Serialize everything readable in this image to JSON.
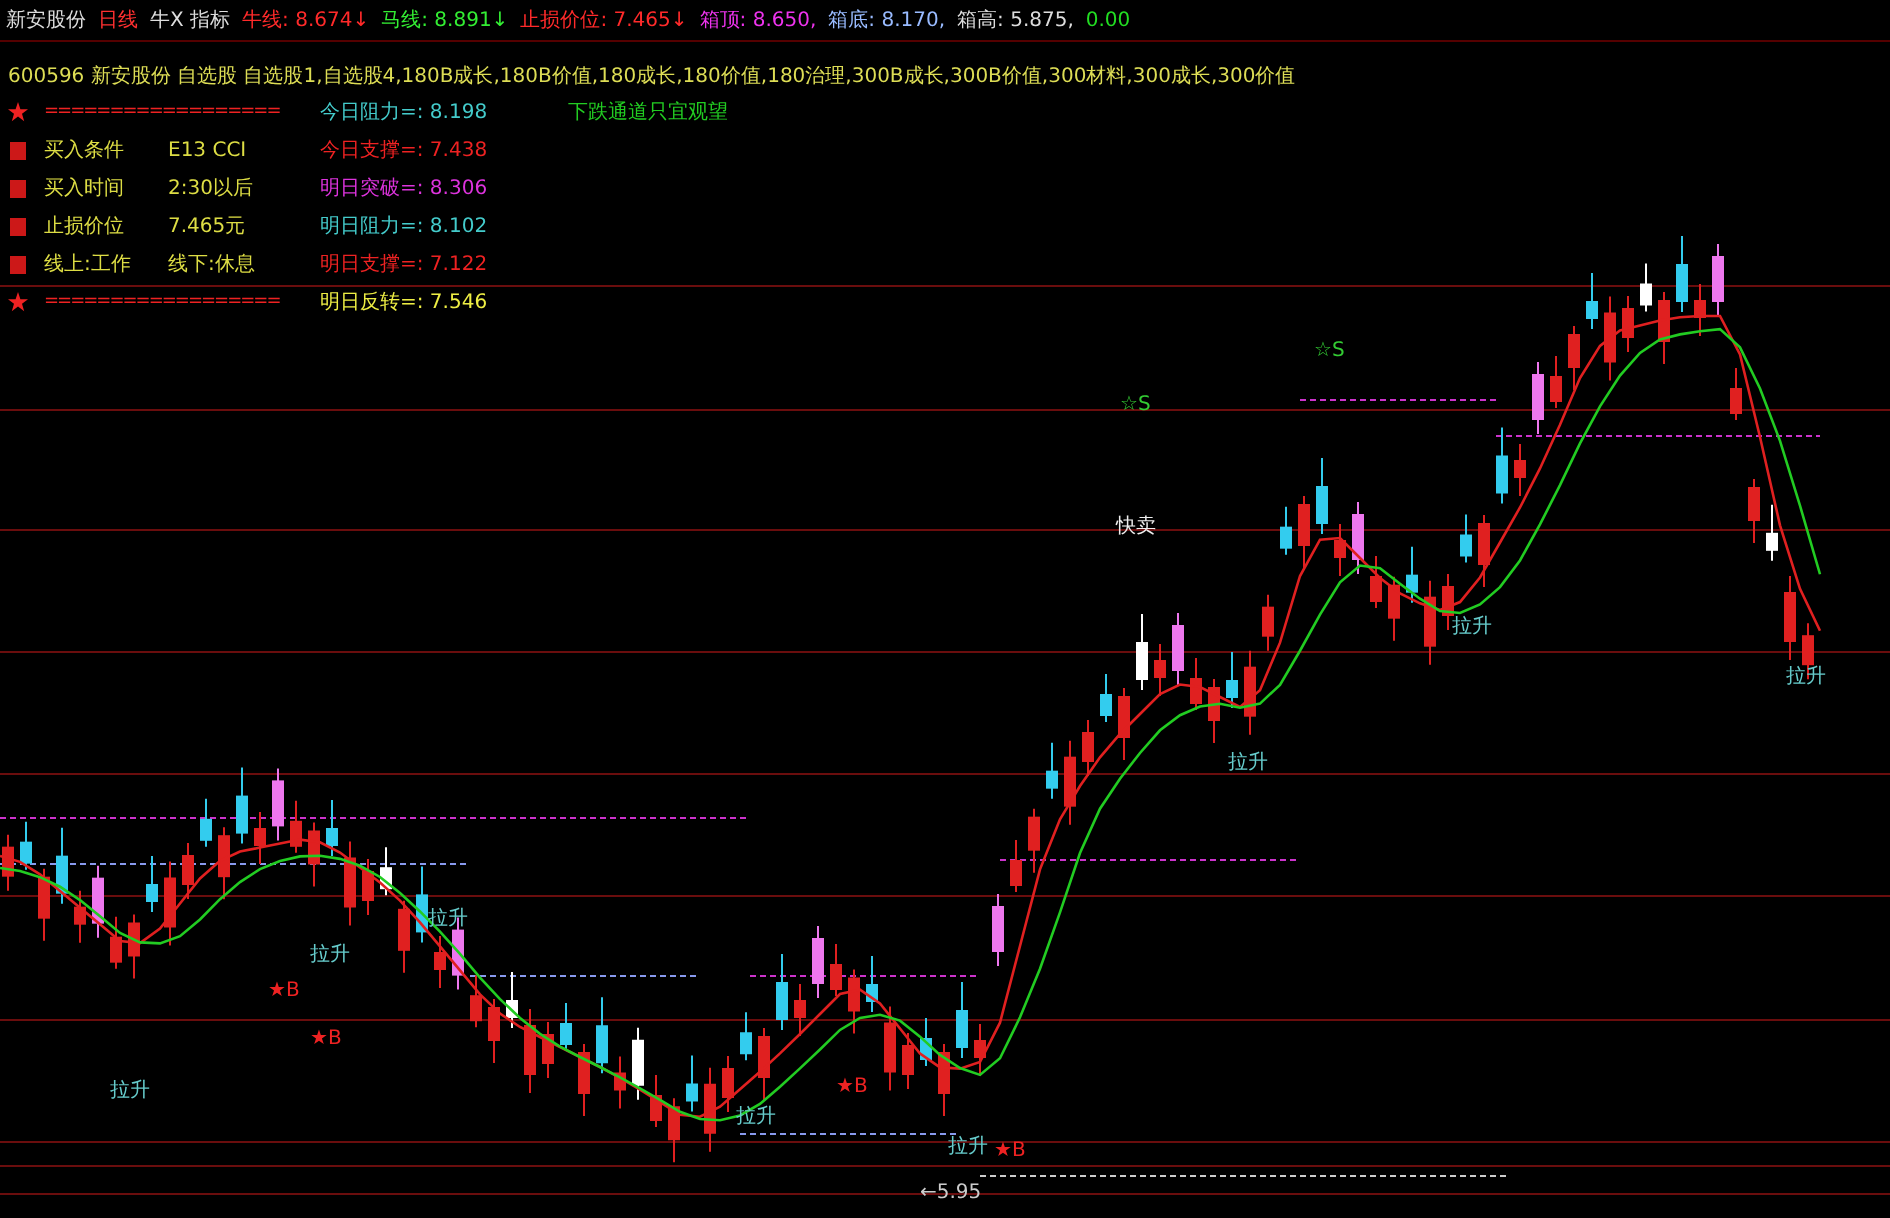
{
  "header": {
    "stock_name": "新安股份",
    "period": "日线",
    "indicator": "牛X 指标",
    "values": [
      {
        "label": "牛线:",
        "value": "8.674↓",
        "color": "#ff2a2a"
      },
      {
        "label": "马线:",
        "value": "8.891↓",
        "color": "#33ee33"
      },
      {
        "label": "止损价位:",
        "value": "7.465↓",
        "color": "#ff2a2a"
      },
      {
        "label": "箱顶:",
        "value": "8.650,",
        "color": "#ee33ee"
      },
      {
        "label": "箱底:",
        "value": "8.170,",
        "color": "#99bbff"
      },
      {
        "label": "箱高:",
        "value": "5.875,",
        "color": "#dddddd"
      },
      {
        "value": "0.00",
        "color": "#22dd22"
      }
    ]
  },
  "sector_line": "600596 新安股份 自选股 自选股1,自选股4,180B成长,180B价值,180成长,180价值,180治理,300B成长,300B价值,300材料,300成长,300价值",
  "info_panel": {
    "rows": [
      {
        "kind": "star",
        "left": "==================",
        "right": "今日阻力=: 8.198",
        "color": "#44cccc"
      },
      {
        "kind": "item",
        "left": "买入条件",
        "left_value": "E13 CCI",
        "right": "今日支撑=: 7.438",
        "color": "#ee2222"
      },
      {
        "kind": "item",
        "left": "买入时间",
        "left_value": "2:30以后",
        "right": "明日突破=: 8.306",
        "color": "#dd33dd"
      },
      {
        "kind": "item",
        "left": "止损价位",
        "left_value": "7.465元",
        "right": "明日阻力=: 8.102",
        "color": "#44cccc"
      },
      {
        "kind": "item",
        "left": "线上:工作",
        "left_value": "线下:休息",
        "right": "明日支撑=: 7.122",
        "color": "#ee2222"
      },
      {
        "kind": "star",
        "left": "==================",
        "right": "明日反转=: 7.546",
        "color": "#eeee44"
      }
    ],
    "trend_note": "下跌通道只宜观望"
  },
  "chart": {
    "signals": [
      {
        "kind": "sell_star",
        "text": "☆S"
      },
      {
        "kind": "sell_star",
        "text": "☆S"
      },
      {
        "kind": "sell",
        "text": "快卖"
      },
      {
        "kind": "rise",
        "text": "拉升"
      },
      {
        "kind": "rise",
        "text": "拉升"
      },
      {
        "kind": "rise",
        "text": "拉升"
      },
      {
        "kind": "rise",
        "text": "拉升"
      },
      {
        "kind": "rise",
        "text": "拉升"
      },
      {
        "kind": "rise",
        "text": "拉升"
      },
      {
        "kind": "rise",
        "text": "拉升"
      },
      {
        "kind": "rise",
        "text": "拉升"
      },
      {
        "kind": "buy_star",
        "text": "★B"
      },
      {
        "kind": "buy_star",
        "text": "★B"
      },
      {
        "kind": "buy_star",
        "text": "★B"
      },
      {
        "kind": "buy_star",
        "text": "★B"
      },
      {
        "kind": "low_mark",
        "text": "←5.95"
      }
    ]
  }
}
